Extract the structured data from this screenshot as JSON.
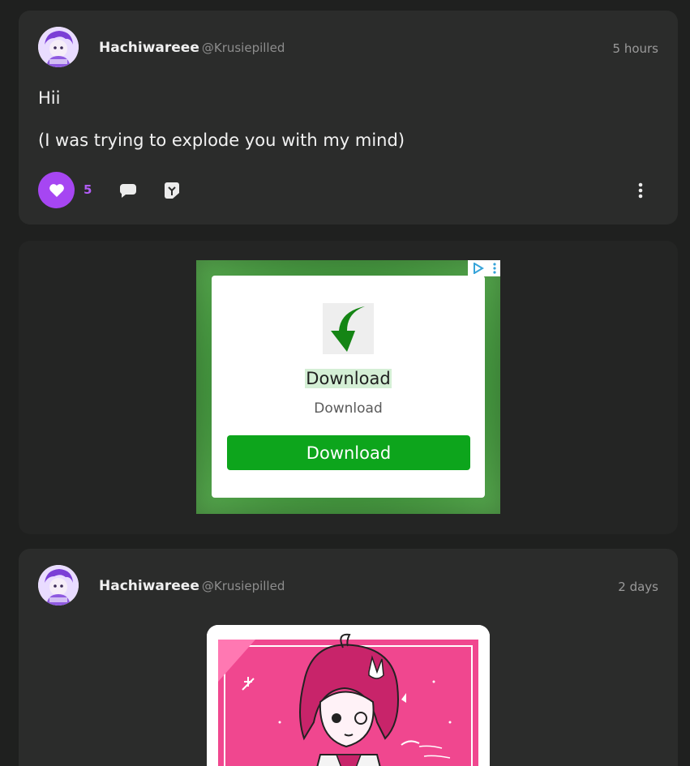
{
  "posts": [
    {
      "display_name": "Hachiwareee",
      "handle": "@Krusiepilled",
      "timestamp": "5 hours",
      "lines": [
        "Hii",
        "(I was trying to explode you with my mind)"
      ],
      "like_count": "5",
      "liked": true,
      "icons": [
        "heart-icon",
        "comment-icon",
        "reblog-icon",
        "more-icon"
      ]
    },
    {
      "display_name": "Hachiwareee",
      "handle": "@Krusiepilled",
      "timestamp": "2 days"
    }
  ],
  "ad": {
    "title": "Download",
    "subtitle": "Download",
    "button_label": "Download",
    "icon": "download-arrow-icon",
    "colors": {
      "frame": "#3e8f39",
      "button": "#0da51c",
      "arrow": "#158515"
    }
  },
  "colors": {
    "background": "#1f201f",
    "card": "#2b2c2b",
    "accent": "#a646f2",
    "like_count": "#b15cf5"
  }
}
